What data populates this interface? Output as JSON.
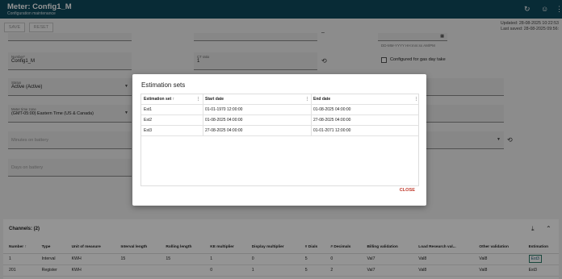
{
  "header": {
    "title": "Meter: Config1_M",
    "subtitle": "Configuration maintenance",
    "refresh_icon": "refresh-icon",
    "user_icon": "user-icon",
    "more_icon": "more-vert-icon"
  },
  "toolbar": {
    "save_label": "SAVE",
    "reset_label": "RESET"
  },
  "updated": {
    "updated_text": "Updated: 28-08-2025 10:22:53",
    "saved_text": "Last saved: 28-08-2025 09:56:"
  },
  "form": {
    "number_label": "Number*",
    "number_value": "Config1_M",
    "ct_ratio_label": "CT ratio",
    "ct_ratio_value": "1",
    "gas_day_label": "Configured for gas day take",
    "date_hint": "DD-MM-YYYY HH:mm:ss AM/PM",
    "status_label": "Status",
    "status_value": "Active (Active)",
    "timezone_label": "Meter time zone",
    "timezone_value": "(GMT-05:00) Eastern Time (US & Canada)",
    "minutes_on_battery": "Minutes on battery",
    "days_on_battery": "Days on battery"
  },
  "channels": {
    "title": "Channels: (2)",
    "columns": [
      "Number",
      "Type",
      "Unit of measure",
      "Interval length",
      "Rolling length",
      "KE multiplier",
      "Display multiplier",
      "# Dials",
      "# Decimals",
      "Billing validation",
      "Load Research val...",
      "Other validation",
      "Estimation"
    ],
    "rows": [
      [
        "1",
        "Interval",
        "KWH",
        "15",
        "15",
        "1",
        "0",
        "5",
        "0",
        "Val7",
        "Val8",
        "Val8",
        "Est3"
      ],
      [
        "201",
        "Register",
        "KWH",
        "",
        "",
        "0",
        "1",
        "5",
        "2",
        "Val7",
        "Val8",
        "Val8",
        "Est3"
      ]
    ]
  },
  "modal": {
    "title": "Estimation sets",
    "col_estimation_set": "Estimation set",
    "col_start_date": "Start date",
    "col_end_date": "End date",
    "rows": [
      {
        "set": "Est1",
        "start": "01-01-1970 12:00:00",
        "end": "01-08-2025 04:00:00"
      },
      {
        "set": "Est2",
        "start": "01-08-2025 04:00:00",
        "end": "27-08-2025 04:00:00"
      },
      {
        "set": "Est3",
        "start": "27-08-2025 04:00:00",
        "end": "01-01-2071 12:00:00"
      }
    ],
    "close_label": "CLOSE"
  },
  "colors": {
    "header_bg": "#0f4a5e",
    "accent_red": "#c0392b",
    "link": "#1f5f7a"
  }
}
